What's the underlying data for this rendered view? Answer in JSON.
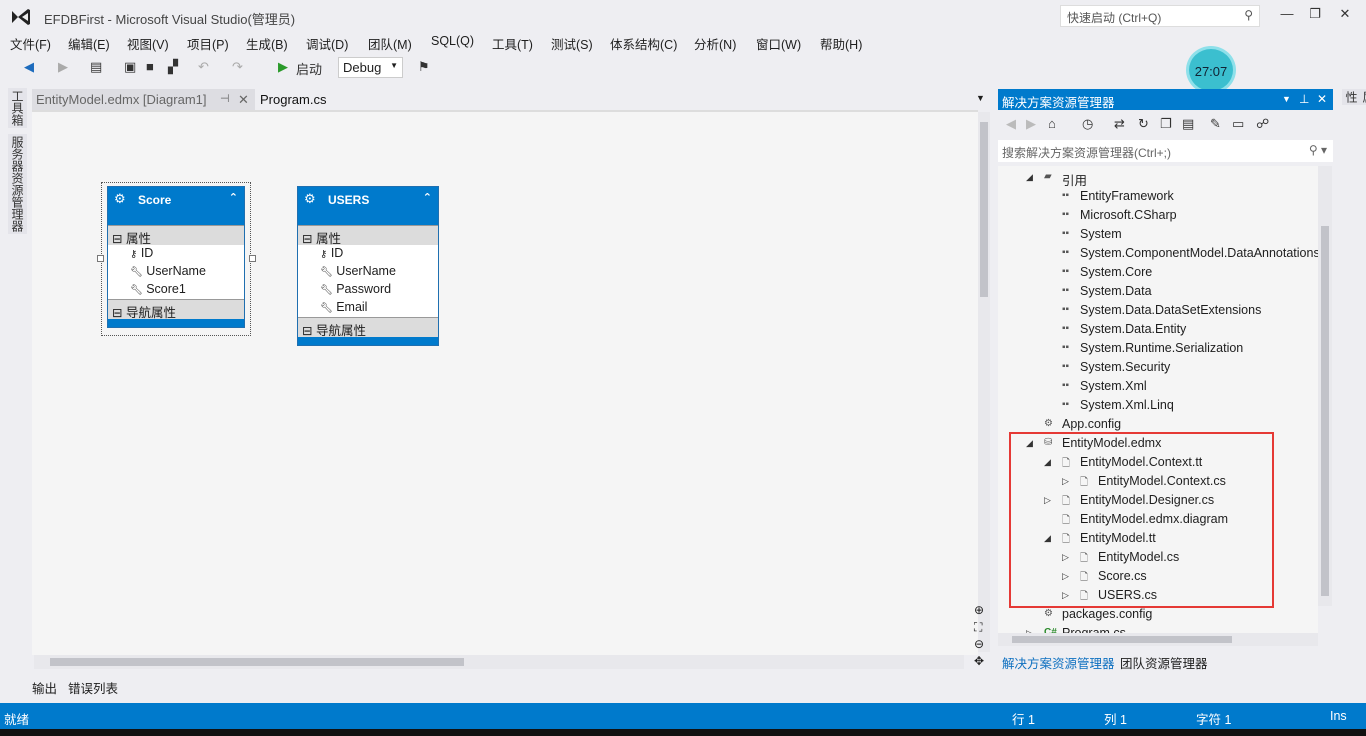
{
  "window": {
    "title": "EFDBFirst - Microsoft Visual Studio(管理员)",
    "quick_launch_placeholder": "快速启动 (Ctrl+Q)",
    "min": "—",
    "max": "❐",
    "close": "✕"
  },
  "menu": [
    "文件(F)",
    "编辑(E)",
    "视图(V)",
    "项目(P)",
    "生成(B)",
    "调试(D)",
    "团队(M)",
    "SQL(Q)",
    "工具(T)",
    "测试(S)",
    "体系结构(C)",
    "分析(N)",
    "窗口(W)",
    "帮助(H)"
  ],
  "toolbar": {
    "start_label": "启动",
    "config": "Debug"
  },
  "left_strip": [
    "工具箱",
    "服务器资源管理器"
  ],
  "tabs": [
    {
      "label": "EntityModel.edmx [Diagram1]",
      "pin": "⊣",
      "close": "✕"
    },
    {
      "label": "Program.cs"
    }
  ],
  "entities": [
    {
      "name": "Score",
      "props_label": "属性",
      "props": [
        "ID",
        "UserName",
        "Score1"
      ],
      "nav_label": "导航属性"
    },
    {
      "name": "USERS",
      "props_label": "属性",
      "props": [
        "ID",
        "UserName",
        "Password",
        "Email"
      ],
      "nav_label": "导航属性"
    }
  ],
  "bottom_tabs": [
    "输出",
    "错误列表"
  ],
  "solution": {
    "title": "解决方案资源管理器",
    "search_placeholder": "搜索解决方案资源管理器(Ctrl+;)",
    "tree": [
      {
        "label": "引用",
        "level": 1,
        "arrow": "◢",
        "icon": "folder"
      },
      {
        "label": "EntityFramework",
        "level": 2,
        "icon": "ref"
      },
      {
        "label": "Microsoft.CSharp",
        "level": 2,
        "icon": "ref"
      },
      {
        "label": "System",
        "level": 2,
        "icon": "ref"
      },
      {
        "label": "System.ComponentModel.DataAnnotations",
        "level": 2,
        "icon": "ref"
      },
      {
        "label": "System.Core",
        "level": 2,
        "icon": "ref"
      },
      {
        "label": "System.Data",
        "level": 2,
        "icon": "ref"
      },
      {
        "label": "System.Data.DataSetExtensions",
        "level": 2,
        "icon": "ref"
      },
      {
        "label": "System.Data.Entity",
        "level": 2,
        "icon": "ref"
      },
      {
        "label": "System.Runtime.Serialization",
        "level": 2,
        "icon": "ref"
      },
      {
        "label": "System.Security",
        "level": 2,
        "icon": "ref"
      },
      {
        "label": "System.Xml",
        "level": 2,
        "icon": "ref"
      },
      {
        "label": "System.Xml.Linq",
        "level": 2,
        "icon": "ref"
      },
      {
        "label": "App.config",
        "level": 1,
        "icon": "config"
      },
      {
        "label": "EntityModel.edmx",
        "level": 1,
        "arrow": "◢",
        "icon": "edmx"
      },
      {
        "label": "EntityModel.Context.tt",
        "level": 2,
        "arrow": "◢",
        "icon": "file"
      },
      {
        "label": "EntityModel.Context.cs",
        "level": 3,
        "arrow": "▷",
        "icon": "file"
      },
      {
        "label": "EntityModel.Designer.cs",
        "level": 2,
        "arrow": "▷",
        "icon": "file"
      },
      {
        "label": "EntityModel.edmx.diagram",
        "level": 2,
        "icon": "file"
      },
      {
        "label": "EntityModel.tt",
        "level": 2,
        "arrow": "◢",
        "icon": "file"
      },
      {
        "label": "EntityModel.cs",
        "level": 3,
        "arrow": "▷",
        "icon": "file"
      },
      {
        "label": "Score.cs",
        "level": 3,
        "arrow": "▷",
        "icon": "file"
      },
      {
        "label": "USERS.cs",
        "level": 3,
        "arrow": "▷",
        "icon": "file"
      },
      {
        "label": "packages.config",
        "level": 1,
        "icon": "config"
      },
      {
        "label": "Program.cs",
        "level": 1,
        "arrow": "▷",
        "icon": "cs"
      }
    ],
    "bottom_tabs": [
      "解决方案资源管理器",
      "团队资源管理器"
    ]
  },
  "right_strip": "属性",
  "clock": "27:07",
  "status": {
    "ready": "就绪",
    "line": "行 1",
    "col": "列 1",
    "char": "字符 1",
    "mode": "Ins"
  },
  "colors": {
    "accent": "#007acc",
    "highlight": "#e53935"
  }
}
